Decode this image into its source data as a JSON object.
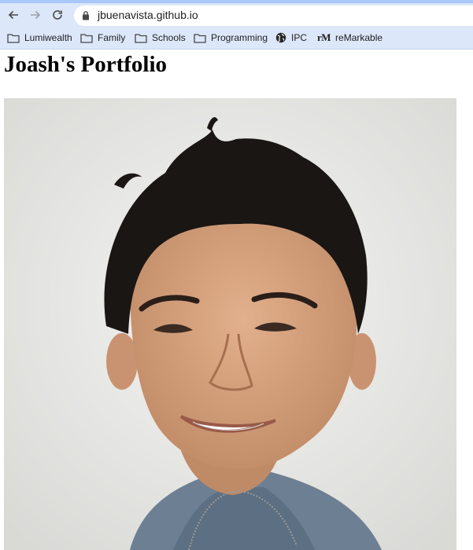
{
  "browser": {
    "url": "jbuenavista.github.io",
    "nav": {
      "back_icon": "arrow-left-icon",
      "forward_icon": "arrow-right-icon",
      "reload_icon": "reload-icon"
    },
    "bookmarks": [
      {
        "label": "Lumiwealth",
        "icon": "folder-icon"
      },
      {
        "label": "Family",
        "icon": "folder-icon"
      },
      {
        "label": "Schools",
        "icon": "folder-icon"
      },
      {
        "label": "Programming",
        "icon": "folder-icon"
      },
      {
        "label": "IPC",
        "icon": "globe-icon"
      },
      {
        "label": "reMarkable",
        "icon": "remarkable-logo",
        "logo_text": "rM"
      }
    ]
  },
  "page": {
    "title": "Joash's Portfolio",
    "photo": {
      "subject": "portrait-photo"
    }
  },
  "colors": {
    "toolbar": "#dce7fa",
    "accent": "#a8c7fa",
    "text": "#1f1f1f"
  }
}
